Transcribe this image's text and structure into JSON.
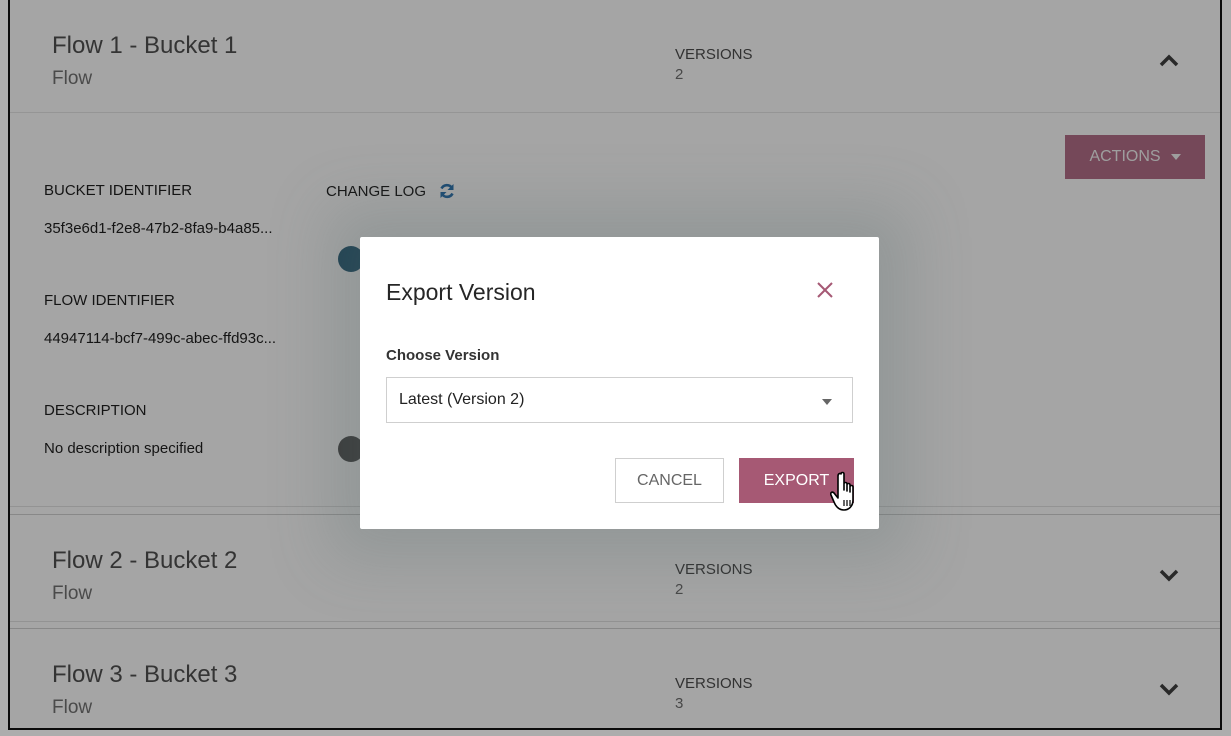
{
  "flows": [
    {
      "name": "Flow 1 - Bucket 1",
      "type": "Flow",
      "versions_label": "VERSIONS",
      "versions": "2",
      "expanded": true,
      "chevron": "chevron-up-icon"
    },
    {
      "name": "Flow 2 - Bucket 2",
      "type": "Flow",
      "versions_label": "VERSIONS",
      "versions": "2",
      "expanded": false,
      "chevron": "chevron-down-icon"
    },
    {
      "name": "Flow 3 - Bucket 3",
      "type": "Flow",
      "versions_label": "VERSIONS",
      "versions": "3",
      "expanded": false,
      "chevron": "chevron-down-icon"
    }
  ],
  "details": {
    "actions_label": "ACTIONS",
    "bucket_identifier_label": "BUCKET IDENTIFIER",
    "bucket_identifier": "35f3e6d1-f2e8-47b2-8fa9-b4a85...",
    "flow_identifier_label": "FLOW IDENTIFIER",
    "flow_identifier": "44947114-bcf7-499c-abec-ffd93c...",
    "description_label": "DESCRIPTION",
    "description": "No description specified",
    "change_log_label": "CHANGE LOG",
    "refresh_icon": "refresh-icon"
  },
  "dialog": {
    "title": "Export Version",
    "field_label": "Choose Version",
    "selected_version": "Latest (Version 2)",
    "cancel_label": "CANCEL",
    "export_label": "EXPORT"
  },
  "colors": {
    "accent": "#a65974",
    "refresh_icon": "#2c6fa8"
  }
}
